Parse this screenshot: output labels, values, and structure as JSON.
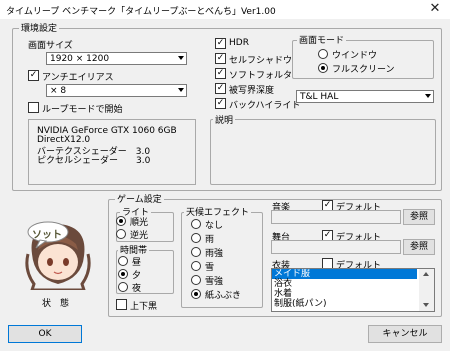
{
  "window": {
    "title": "タイムリープ ベンチマーク「タイムリープぶーとべんち」Ver1.00",
    "close": "✕"
  },
  "env": {
    "label": "環境設定",
    "screen_size": {
      "label": "画面サイズ",
      "value": "1920 × 1200"
    },
    "antialias": {
      "label": "アンチエイリアス",
      "checked": true,
      "value": "× 8"
    },
    "loop_start": {
      "label": "ループモードで開始",
      "checked": false
    },
    "sysinfo": [
      "NVIDIA GeForce GTX 1060 6GB",
      "DirectX12.0",
      "バーテクスシェーダー　3.0",
      "ピクセルシェーダー　　3.0"
    ],
    "effects": [
      {
        "label": "HDR",
        "checked": true
      },
      {
        "label": "セルフシャドウ",
        "checked": true
      },
      {
        "label": "ソフトフォルタ",
        "checked": true
      },
      {
        "label": "被写界深度",
        "checked": true
      },
      {
        "label": "バックハイライト",
        "checked": true
      }
    ],
    "screen_mode": {
      "label": "画面モード",
      "options": [
        "ウインドウ",
        "フルスクリーン"
      ],
      "selected": 1
    },
    "shader_combo": "T&L HAL",
    "desc_label": "説明"
  },
  "game": {
    "label": "ゲーム設定",
    "status_label": "状　態",
    "avatar_bubble": "ソット",
    "light": {
      "label": "ライト",
      "options": [
        "順光",
        "逆光"
      ],
      "selected": 0
    },
    "time": {
      "label": "時間帯",
      "options": [
        "昼",
        "夕",
        "夜"
      ],
      "selected": 1
    },
    "letterbox": {
      "label": "上下黒",
      "checked": false
    },
    "weather": {
      "label": "天候エフェクト",
      "options": [
        "なし",
        "雨",
        "雨強",
        "雪",
        "雪強",
        "紙ふぶき"
      ],
      "selected": 5
    },
    "music": {
      "label": "音楽",
      "default_label": "デフォルト",
      "checked": true,
      "browse": "参照"
    },
    "stage": {
      "label": "舞台",
      "default_label": "デフォルト",
      "checked": true,
      "browse": "参照"
    },
    "costume": {
      "label": "衣装",
      "default_label": "デフォルト",
      "checked": false,
      "items": [
        "メイド服",
        "浴衣",
        "水着",
        "制服(紙パン)"
      ],
      "selected": 0
    }
  },
  "footer": {
    "ok": "OK",
    "cancel": "キャンセル"
  },
  "colors": {
    "select": "#0078d7",
    "accent": "#3a3a8a"
  }
}
